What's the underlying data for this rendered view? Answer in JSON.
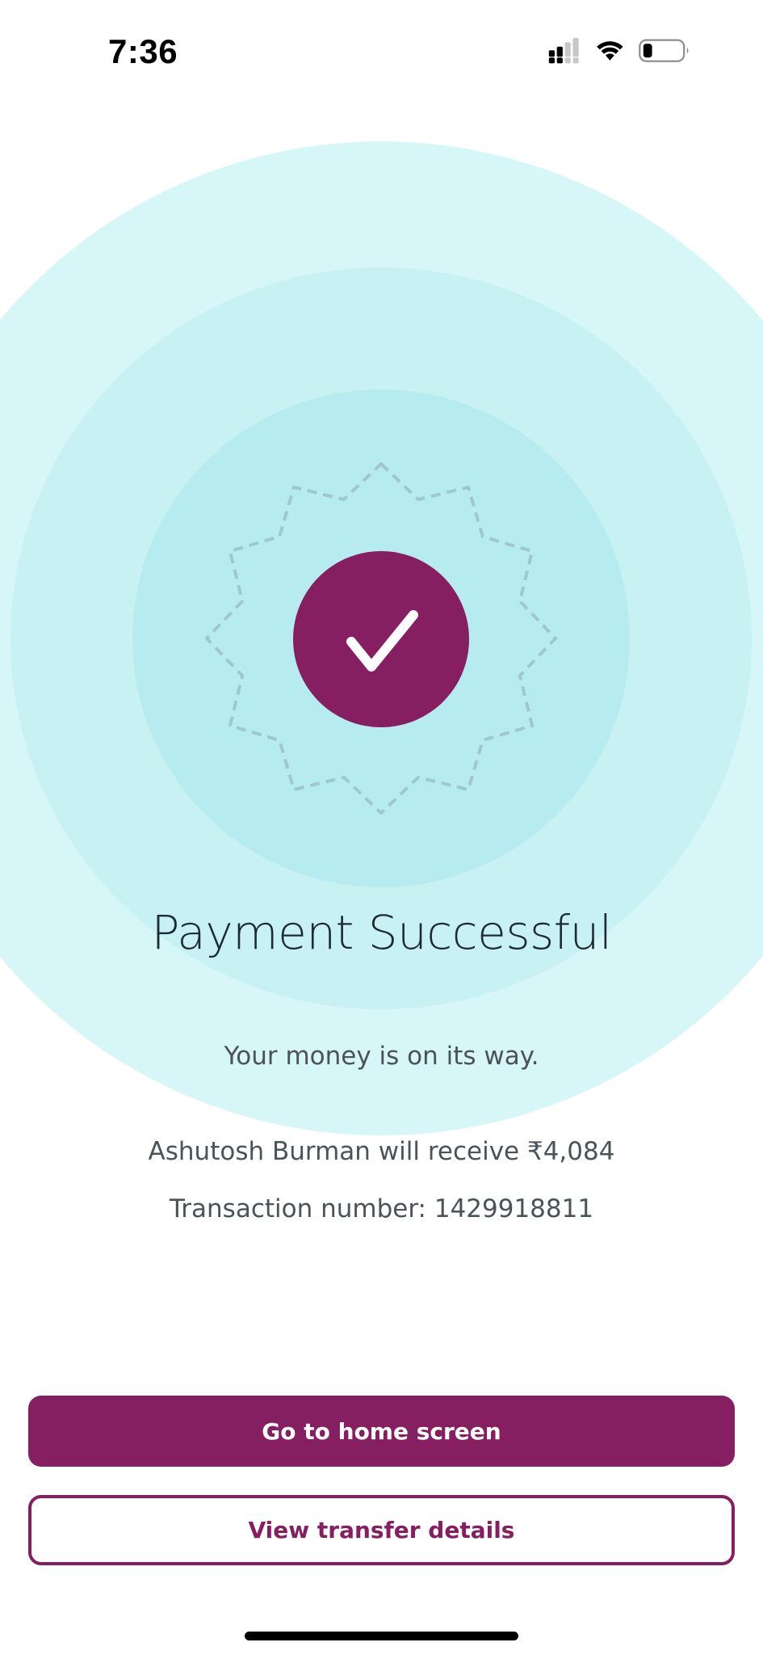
{
  "status_bar": {
    "time": "7:36",
    "icons": [
      "signal-icon",
      "wifi-icon",
      "battery-icon"
    ]
  },
  "result": {
    "icon": "checkmark-icon",
    "title": "Payment Successful",
    "subtitle": "Your money is on its way.",
    "recipient_line": "Ashutosh Burman will receive ₹4,084",
    "transaction_line": "Transaction number: 1429918811"
  },
  "actions": {
    "primary_label": "Go to home screen",
    "secondary_label": "View transfer details"
  },
  "colors": {
    "accent": "#861f61",
    "ring_outer": "#d7f6f7",
    "ring_mid": "#c8f1f3",
    "ring_inner": "#b6ecef"
  }
}
